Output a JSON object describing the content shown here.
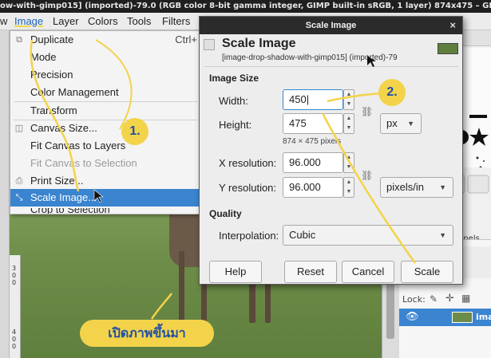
{
  "window_title": "ow-with-gimp015] (imported)-79.0 (RGB color 8-bit gamma integer, GIMP built-in sRGB, 1 layer) 874x475 – GIMP",
  "menubar": {
    "items": [
      "w",
      "Image",
      "Layer",
      "Colors",
      "Tools",
      "Filters"
    ]
  },
  "image_menu": {
    "items": [
      {
        "label": "Duplicate",
        "accel": "Ctrl+",
        "icon": "duplicate-icon",
        "state": "normal"
      },
      {
        "label": "Mode",
        "accel": "",
        "icon": "",
        "state": "normal"
      },
      {
        "label": "Precision",
        "accel": "",
        "icon": "",
        "state": "normal"
      },
      {
        "label": "Color Management",
        "accel": "",
        "icon": "",
        "state": "normal"
      },
      {
        "label": "Transform",
        "accel": "",
        "icon": "",
        "state": "normal"
      },
      {
        "label": "Canvas Size...",
        "accel": "",
        "icon": "canvas-size-icon",
        "state": "normal"
      },
      {
        "label": "Fit Canvas to Layers",
        "accel": "",
        "icon": "",
        "state": "normal"
      },
      {
        "label": "Fit Canvas to Selection",
        "accel": "",
        "icon": "",
        "state": "disabled"
      },
      {
        "label": "Print Size...",
        "accel": "",
        "icon": "print-size-icon",
        "state": "normal"
      },
      {
        "label": "Scale Image...",
        "accel": "",
        "icon": "scale-image-icon",
        "state": "highlighted"
      },
      {
        "label": "Crop to Selection",
        "accel": "",
        "icon": "",
        "state": "cut"
      }
    ]
  },
  "dialog": {
    "title": "Scale Image",
    "close_glyph": "×",
    "heading": "Scale Image",
    "subheading": "[image-drop-shadow-with-gimp015] (imported)-79",
    "image_size_label": "Image Size",
    "width_label": "Width:",
    "width_value": "450",
    "height_label": "Height:",
    "height_value": "475",
    "size_info": "874 × 475 pixels",
    "unit": "px",
    "x_res_label": "X resolution:",
    "x_res_value": "96.000",
    "y_res_label": "Y resolution:",
    "y_res_value": "96.000",
    "res_unit": "pixels/in",
    "quality_label": "Quality",
    "interpolation_label": "Interpolation:",
    "interpolation_value": "Cubic",
    "buttons": {
      "help": "Help",
      "reset": "Reset",
      "cancel": "Cancel",
      "scale": "Scale"
    }
  },
  "dock": {
    "channels_label": "nnels",
    "lock_label": "Lock:",
    "layer_name": "ima"
  },
  "annotations": {
    "step1": "1.",
    "step2": "2.",
    "caption": "เปิดภาพขึ้นมา"
  },
  "ruler_ticks": [
    "3",
    "0",
    "0",
    "4",
    "0",
    "0"
  ],
  "colors": {
    "accent_highlight": "#3a84d0",
    "annotation_yellow": "#f3d34a",
    "annotation_text": "#1f4fa8"
  }
}
